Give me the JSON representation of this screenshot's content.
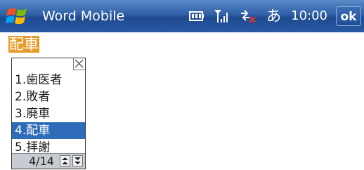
{
  "titlebar": {
    "app_title": "Word Mobile",
    "ime_mode": "あ",
    "clock": "10:00",
    "ok_label": "ok",
    "icons": [
      "windows-start-icon",
      "battery-icon",
      "signal-icon",
      "connectivity-icon"
    ]
  },
  "document": {
    "composition_text": "配車"
  },
  "candidates": {
    "items": [
      {
        "label": "1.歯医者"
      },
      {
        "label": "2.敗者"
      },
      {
        "label": "3.廃車"
      },
      {
        "label": "4.配車"
      },
      {
        "label": "5.拝謝"
      }
    ],
    "selected_index": 3,
    "page_indicator": "4/14"
  },
  "colors": {
    "titlebar": "#2f5fa8",
    "composition_highlight": "#e69a2a",
    "selection": "#2e6bb8",
    "footer": "#c8ccd2"
  }
}
